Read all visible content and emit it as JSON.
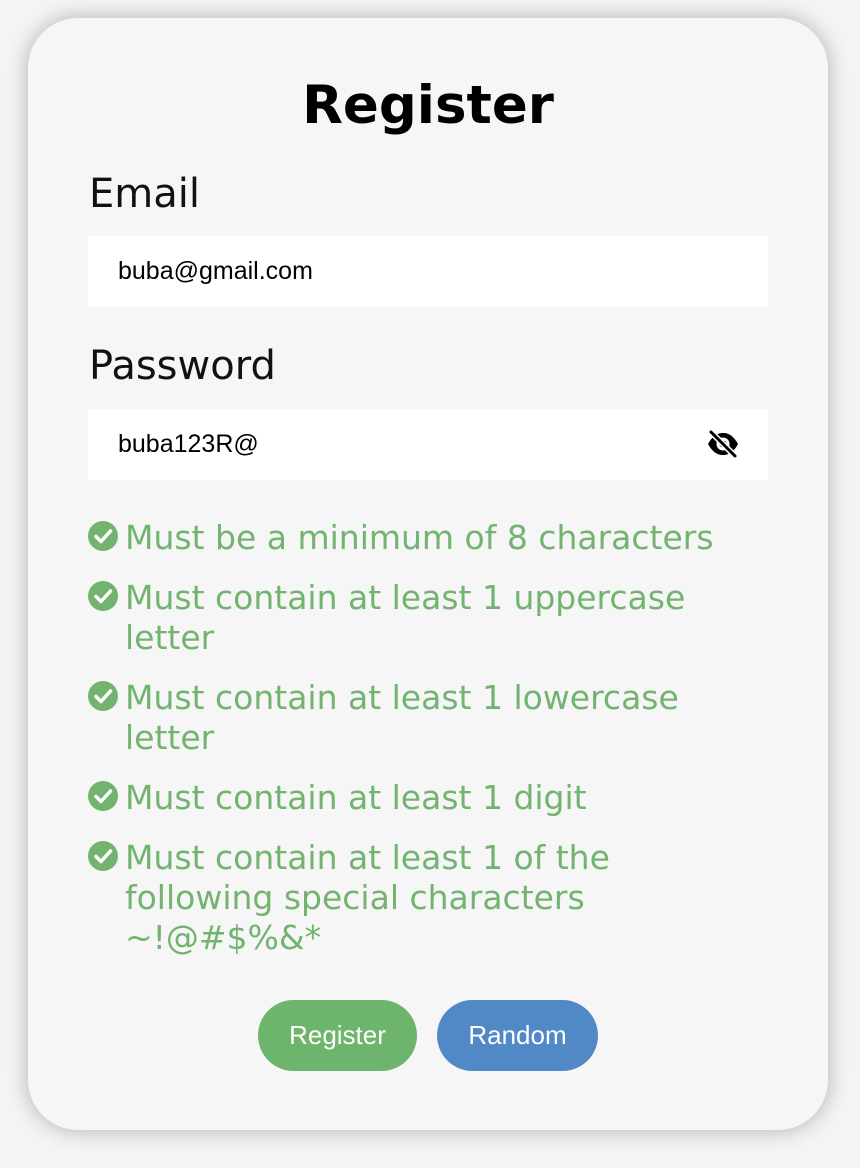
{
  "form": {
    "title": "Register",
    "email": {
      "label": "Email",
      "value": "buba@gmail.com"
    },
    "password": {
      "label": "Password",
      "value": "buba123R@",
      "toggle_icon": "eye-slash-icon"
    },
    "rules": [
      {
        "text": "Must be a minimum of 8 characters",
        "icon": "check-circle-icon",
        "met": true
      },
      {
        "text": "Must contain at least 1 uppercase letter",
        "icon": "check-circle-icon",
        "met": true
      },
      {
        "text": "Must contain at least 1 lowercase letter",
        "icon": "check-circle-icon",
        "met": true
      },
      {
        "text": "Must contain at least 1 digit",
        "icon": "check-circle-icon",
        "met": true
      },
      {
        "text": "Must contain at least 1 of the following special characters ~!@#$%&*",
        "icon": "check-circle-icon",
        "met": true
      }
    ],
    "buttons": {
      "register_label": "Register",
      "random_label": "Random"
    }
  },
  "colors": {
    "rule_met": "#72b46f",
    "register_button": "#6db46c",
    "random_button": "#5189c6",
    "card_background": "#f6f6f6"
  }
}
